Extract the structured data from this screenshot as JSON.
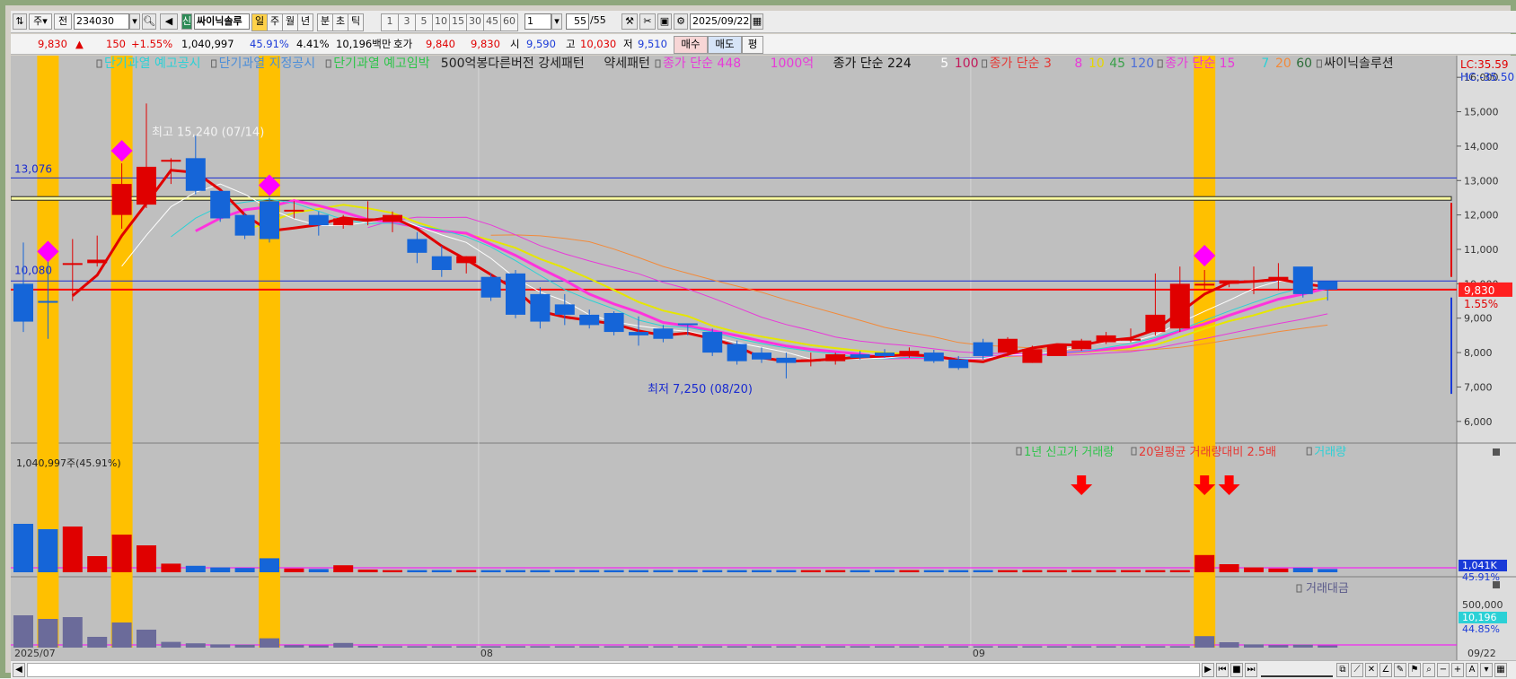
{
  "toolbar": {
    "period_select": "주",
    "prev_label": "전",
    "code_value": "234030",
    "name_value": "싸이닉솔루",
    "periods": [
      "일",
      "주",
      "월",
      "년",
      "분",
      "초",
      "틱"
    ],
    "active_period": "일",
    "intervals": [
      "1",
      "3",
      "5",
      "10",
      "15",
      "30",
      "45",
      "60"
    ],
    "interval_value": "1",
    "count_value": "55",
    "count_total": "/55",
    "date_value": "2025/09/22"
  },
  "quote": {
    "price": "9,830",
    "change_arrow": "▲",
    "change": "150",
    "change_pct": "+1.55%",
    "volume": "1,040,997",
    "vol_ratio": "45.91%",
    "turnover": "4.41%",
    "amount": "10,196백만",
    "ask_label": "호가",
    "ask": "9,840",
    "bid": "9,830",
    "open_label": "시",
    "open": "9,590",
    "high_label": "고",
    "high": "10,030",
    "low_label": "저",
    "low": "9,510",
    "buy_label": "매수",
    "sell_label": "매도",
    "eval_label": "평"
  },
  "legend": [
    {
      "text": "단기과열 예고공시",
      "color": "#2bd1d6"
    },
    {
      "text": "단기과열 지정공시",
      "color": "#4c8ed8"
    },
    {
      "text": "단기과열 예고임박",
      "color": "#2ec44a"
    },
    {
      "text": "500억봉다른버전 강세패턴",
      "color": "#222222"
    },
    {
      "text": "약세패턴",
      "color": "#222222"
    },
    {
      "text": "종가 단순 448",
      "color": "#e83ad9"
    },
    {
      "text": "1000억",
      "color": "#e83ad9"
    },
    {
      "text": "종가 단순 224",
      "color": "#111111"
    },
    {
      "text": "5",
      "color": "#ffffff"
    },
    {
      "text": "100",
      "color": "#c2185b"
    },
    {
      "text": "종가 단순 3",
      "color": "#e53935"
    },
    {
      "text": "8",
      "color": "#e83ad9"
    },
    {
      "text": "10",
      "color": "#e6d600"
    },
    {
      "text": "45",
      "color": "#3aa04a"
    },
    {
      "text": "120",
      "color": "#4c6ed8"
    },
    {
      "text": "종가 단순 15",
      "color": "#e83ad9"
    },
    {
      "text": "7",
      "color": "#2bd1d6"
    },
    {
      "text": "20",
      "color": "#f28a3a"
    },
    {
      "text": "60",
      "color": "#2e6e3a"
    },
    {
      "text": "싸이닉솔루션",
      "color": "#222222"
    }
  ],
  "price_axis": {
    "ticks": [
      16000,
      15000,
      14000,
      13000,
      12000,
      11000,
      10000,
      9000,
      8000,
      7000,
      6000
    ],
    "tick_labels": [
      "16,000",
      "15,000",
      "14,000",
      "13,000",
      "12,000",
      "11,000",
      "10,000",
      "9,000",
      "8,000",
      "7,000",
      "6,000"
    ]
  },
  "annotations": {
    "high_text": "최고 15,240 (07/14)",
    "low_text": "최저 7,250 (08/20)",
    "level_upper": "13,076",
    "level_lower": "10,080",
    "lc": "LC:35.59",
    "hc": "HC:-35.50",
    "last_price": "9,830",
    "last_pct": "1.55%"
  },
  "volume_panel": {
    "label": "1,040,997주(45.91%)",
    "legend": [
      {
        "text": "1년 신고가 거래량",
        "color": "#2ec44a"
      },
      {
        "text": "20일평균 거래량대비 2.5배",
        "color": "#e53935"
      },
      {
        "text": "거래량",
        "color": "#2bd1d6"
      }
    ],
    "axis_value": "1,041K",
    "axis_pct": "45.91%"
  },
  "amount_panel": {
    "legend": "거래대금",
    "axis_tick": "500,000",
    "axis_value": "10,196",
    "axis_pct": "44.85%"
  },
  "date_axis": {
    "labels": [
      "2025/07",
      "08",
      "09",
      "09/22"
    ]
  },
  "chart_data": {
    "type": "candlestick",
    "open": [
      10000,
      9500,
      10600,
      10600,
      12000,
      12300,
      13600,
      13650,
      12700,
      12000,
      12400,
      12150,
      12000,
      11700,
      11900,
      11800,
      11300,
      10800,
      10600,
      10200,
      10300,
      9700,
      9400,
      9100,
      9150,
      8600,
      8700,
      8850,
      8600,
      8250,
      8000,
      7850,
      7800,
      7750,
      7950,
      8000,
      7900,
      8000,
      7800,
      8300,
      8000,
      7700,
      7900,
      8100,
      8300,
      8400,
      8600,
      8700,
      10000,
      10000,
      10100,
      10100,
      10500,
      10080
    ],
    "close": [
      8900,
      9450,
      10600,
      10700,
      12900,
      13400,
      13600,
      12700,
      11900,
      11400,
      11300,
      12150,
      11700,
      11900,
      11900,
      12000,
      10900,
      10400,
      10800,
      9600,
      9100,
      8900,
      9100,
      8800,
      8600,
      8500,
      8400,
      8800,
      8000,
      7750,
      7800,
      7700,
      7800,
      7950,
      7850,
      7900,
      8050,
      7750,
      7550,
      7900,
      8400,
      8100,
      8200,
      8350,
      8500,
      8400,
      9100,
      10000,
      10000,
      10100,
      10100,
      10200,
      9700,
      9830
    ],
    "high": [
      11200,
      11200,
      11300,
      11400,
      13500,
      15240,
      13650,
      14300,
      12600,
      12050,
      12500,
      12400,
      12100,
      12000,
      12400,
      12100,
      11500,
      11100,
      10800,
      10300,
      10400,
      9900,
      9700,
      9250,
      9200,
      9050,
      8800,
      8850,
      8700,
      8350,
      8150,
      8000,
      8000,
      8000,
      8050,
      8100,
      8150,
      8080,
      7900,
      8400,
      8450,
      8200,
      8250,
      8400,
      8600,
      8700,
      10300,
      10500,
      10400,
      10100,
      10500,
      10600,
      10150,
      10030
    ],
    "low": [
      8600,
      8400,
      9500,
      10500,
      11600,
      12200,
      12900,
      12600,
      11800,
      11300,
      11200,
      11900,
      11400,
      11600,
      11700,
      11500,
      10600,
      10200,
      10300,
      9500,
      9000,
      8700,
      8800,
      8700,
      8500,
      8200,
      8300,
      8500,
      7900,
      7650,
      7700,
      7250,
      7600,
      7650,
      7800,
      7850,
      7850,
      7700,
      7500,
      7800,
      7900,
      7700,
      7900,
      8050,
      8250,
      8300,
      8500,
      8600,
      9800,
      9900,
      9700,
      9800,
      9600,
      9510
    ],
    "volume": [
      9,
      8,
      8.5,
      3,
      7,
      5,
      1.6,
      1.2,
      0.9,
      0.8,
      2.6,
      0.7,
      0.6,
      1.3,
      0.5,
      0.4,
      0.4,
      0.4,
      0.4,
      0.4,
      0.4,
      0.4,
      0.4,
      0.4,
      0.4,
      0.4,
      0.4,
      0.4,
      0.4,
      0.4,
      0.4,
      0.4,
      0.4,
      0.4,
      0.4,
      0.4,
      0.4,
      0.4,
      0.4,
      0.4,
      0.4,
      0.4,
      0.4,
      0.4,
      0.4,
      0.4,
      0.4,
      0.4,
      3.2,
      1.5,
      0.9,
      0.7,
      0.8,
      0.6
    ],
    "signal_bars": [
      1,
      4,
      10,
      48
    ],
    "marker_bars": [
      1,
      4,
      10,
      48
    ],
    "ylim": [
      5500,
      16500
    ],
    "dates": {
      "first": "2025/07",
      "aug": 19,
      "sep": 39,
      "last": "09/22"
    }
  },
  "scrollbar": {
    "zoom_out": "−",
    "zoom_in": "+",
    "auto": "A"
  }
}
